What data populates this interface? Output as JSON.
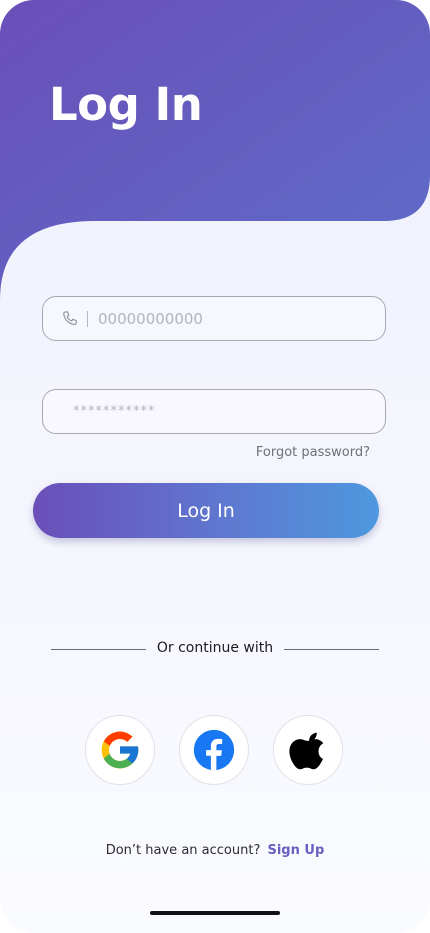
{
  "header": {
    "title": "Log In"
  },
  "form": {
    "phone_placeholder": "00000000000",
    "password_placeholder": "***********",
    "forgot_label": "Forgot password?",
    "login_label": "Log In"
  },
  "social": {
    "divider_label": "Or continue with",
    "providers": [
      {
        "name": "Google",
        "icon": "google-icon"
      },
      {
        "name": "Facebook",
        "icon": "facebook-icon"
      },
      {
        "name": "Apple",
        "icon": "apple-icon"
      }
    ]
  },
  "footer": {
    "prompt": "Don’t have an account?",
    "signup_label": "Sign Up"
  },
  "colors": {
    "gradient_start": "#6a4fb8",
    "gradient_end": "#4d98de",
    "link": "#6a5fc0"
  }
}
